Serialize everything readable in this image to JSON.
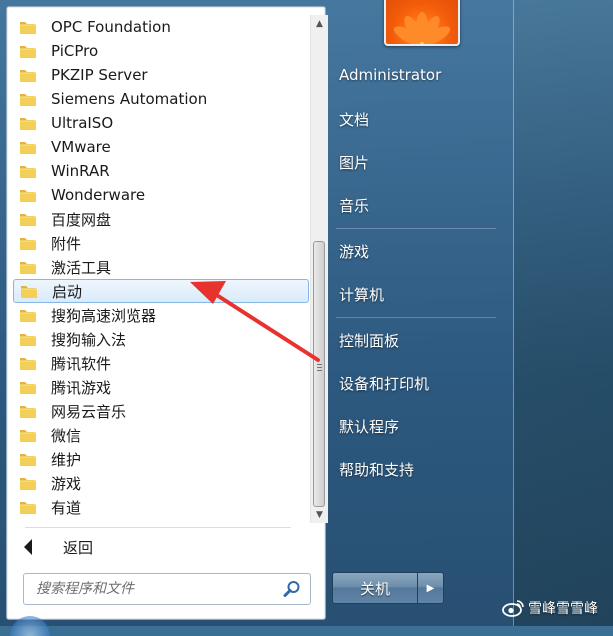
{
  "programs": [
    {
      "label": "OPC Foundation"
    },
    {
      "label": "PiCPro"
    },
    {
      "label": "PKZIP Server"
    },
    {
      "label": "Siemens Automation"
    },
    {
      "label": "UltraISO"
    },
    {
      "label": "VMware"
    },
    {
      "label": "WinRAR"
    },
    {
      "label": "Wonderware"
    },
    {
      "label": "百度网盘"
    },
    {
      "label": "附件"
    },
    {
      "label": "激活工具"
    },
    {
      "label": "启动",
      "selected": true
    },
    {
      "label": "搜狗高速浏览器"
    },
    {
      "label": "搜狗输入法"
    },
    {
      "label": "腾讯软件"
    },
    {
      "label": "腾讯游戏"
    },
    {
      "label": "网易云音乐"
    },
    {
      "label": "微信"
    },
    {
      "label": "维护"
    },
    {
      "label": "游戏"
    },
    {
      "label": "有道"
    }
  ],
  "back_label": "返回",
  "search": {
    "placeholder": "搜索程序和文件"
  },
  "right_panel": {
    "user": "Administrator",
    "items": [
      "文档",
      "图片",
      "音乐",
      "游戏",
      "计算机",
      "控制面板",
      "设备和打印机",
      "默认程序",
      "帮助和支持"
    ]
  },
  "shutdown_label": "关机",
  "watermark": "雪峰雪雪峰",
  "colors": {
    "selection_border": "#88b7e6",
    "annotation_arrow": "#e8322e",
    "folder": "#f2c84b"
  },
  "icons": {
    "folder": "folder-icon",
    "search": "search-icon",
    "back": "back-arrow-icon",
    "shutdown_more": "chevron-right-icon"
  }
}
